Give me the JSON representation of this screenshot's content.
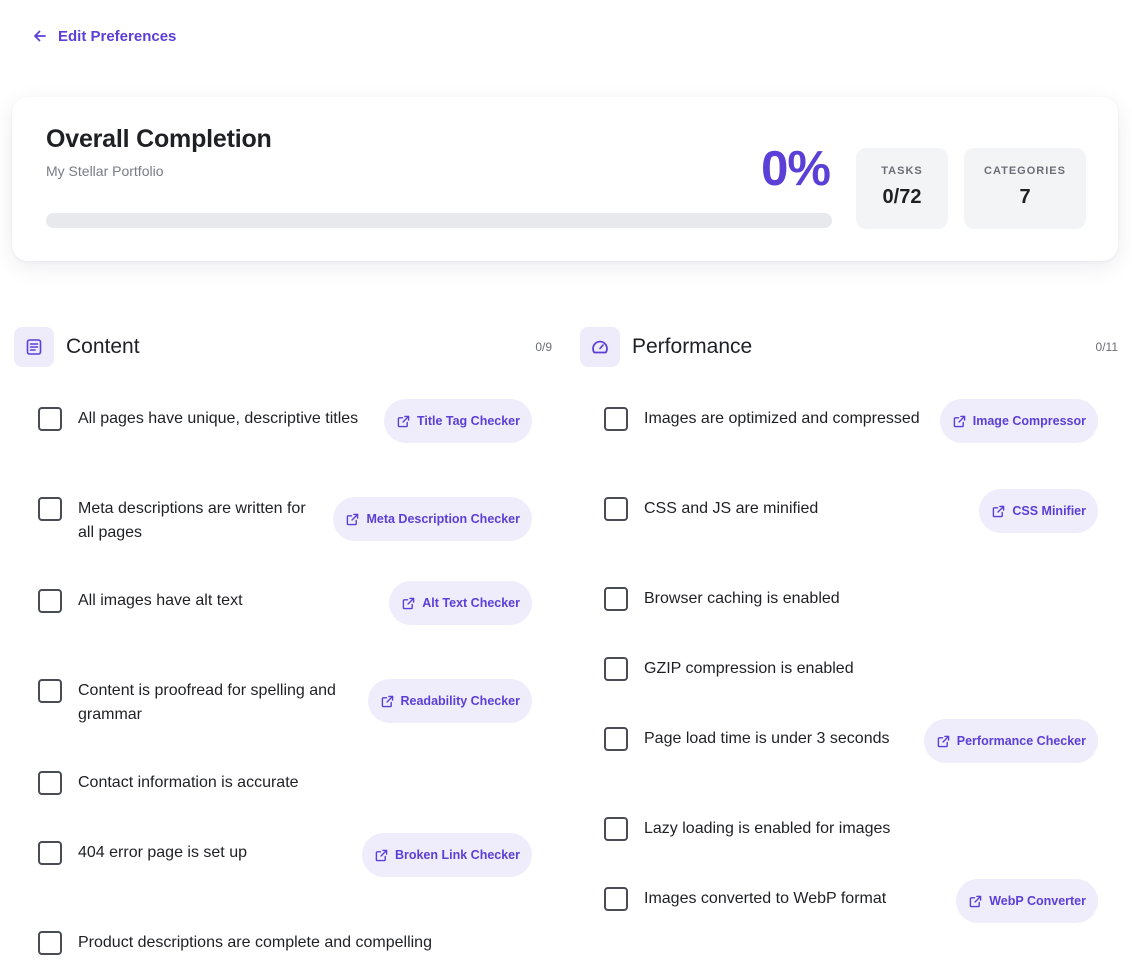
{
  "nav": {
    "back_label": "Edit Preferences"
  },
  "summary": {
    "title": "Overall Completion",
    "subtitle": "My Stellar Portfolio",
    "percent": "0%",
    "progress": 0,
    "tasks_label": "TASKS",
    "tasks_value": "0/72",
    "categories_label": "CATEGORIES",
    "categories_value": "7"
  },
  "content": {
    "title": "Content",
    "count": "0/9",
    "tasks": [
      {
        "text": "All pages have unique, descriptive titles",
        "tool": "Title Tag Checker"
      },
      {
        "text": "Meta descriptions are written for all pages",
        "tool": "Meta Description Checker"
      },
      {
        "text": "All images have alt text",
        "tool": "Alt Text Checker"
      },
      {
        "text": "Content is proofread for spelling and grammar",
        "tool": "Readability Checker"
      },
      {
        "text": "Contact information is accurate",
        "tool": ""
      },
      {
        "text": "404 error page is set up",
        "tool": "Broken Link Checker"
      },
      {
        "text": "Product descriptions are complete and compelling",
        "tool": ""
      }
    ]
  },
  "performance": {
    "title": "Performance",
    "count": "0/11",
    "tasks": [
      {
        "text": "Images are optimized and compressed",
        "tool": "Image Compressor"
      },
      {
        "text": "CSS and JS are minified",
        "tool": "CSS Minifier"
      },
      {
        "text": "Browser caching is enabled",
        "tool": ""
      },
      {
        "text": "GZIP compression is enabled",
        "tool": ""
      },
      {
        "text": "Page load time is under 3 seconds",
        "tool": "Performance Checker"
      },
      {
        "text": "Lazy loading is enabled for images",
        "tool": ""
      },
      {
        "text": "Images converted to WebP format",
        "tool": "WebP Converter"
      }
    ]
  },
  "colors": {
    "accent": "#5b3fd6",
    "accent_bg": "#efecfb"
  }
}
